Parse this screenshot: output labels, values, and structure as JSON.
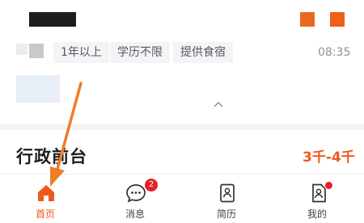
{
  "colors": {
    "accent": "#ef5a1c",
    "badge": "#e5202a",
    "annotation_arrow": "#ef7d2b"
  },
  "job_card": {
    "tags": [
      "1年以上",
      "学历不限",
      "提供食宿"
    ],
    "time": "08:35"
  },
  "job_row": {
    "title": "行政前台",
    "salary": "3千-4千"
  },
  "tabbar": {
    "items": [
      {
        "label": "首页",
        "icon": "home-icon",
        "active": true
      },
      {
        "label": "消息",
        "icon": "chat-icon",
        "badge": "2"
      },
      {
        "label": "简历",
        "icon": "resume-icon"
      },
      {
        "label": "我的",
        "icon": "profile-icon",
        "dot": true
      }
    ]
  }
}
